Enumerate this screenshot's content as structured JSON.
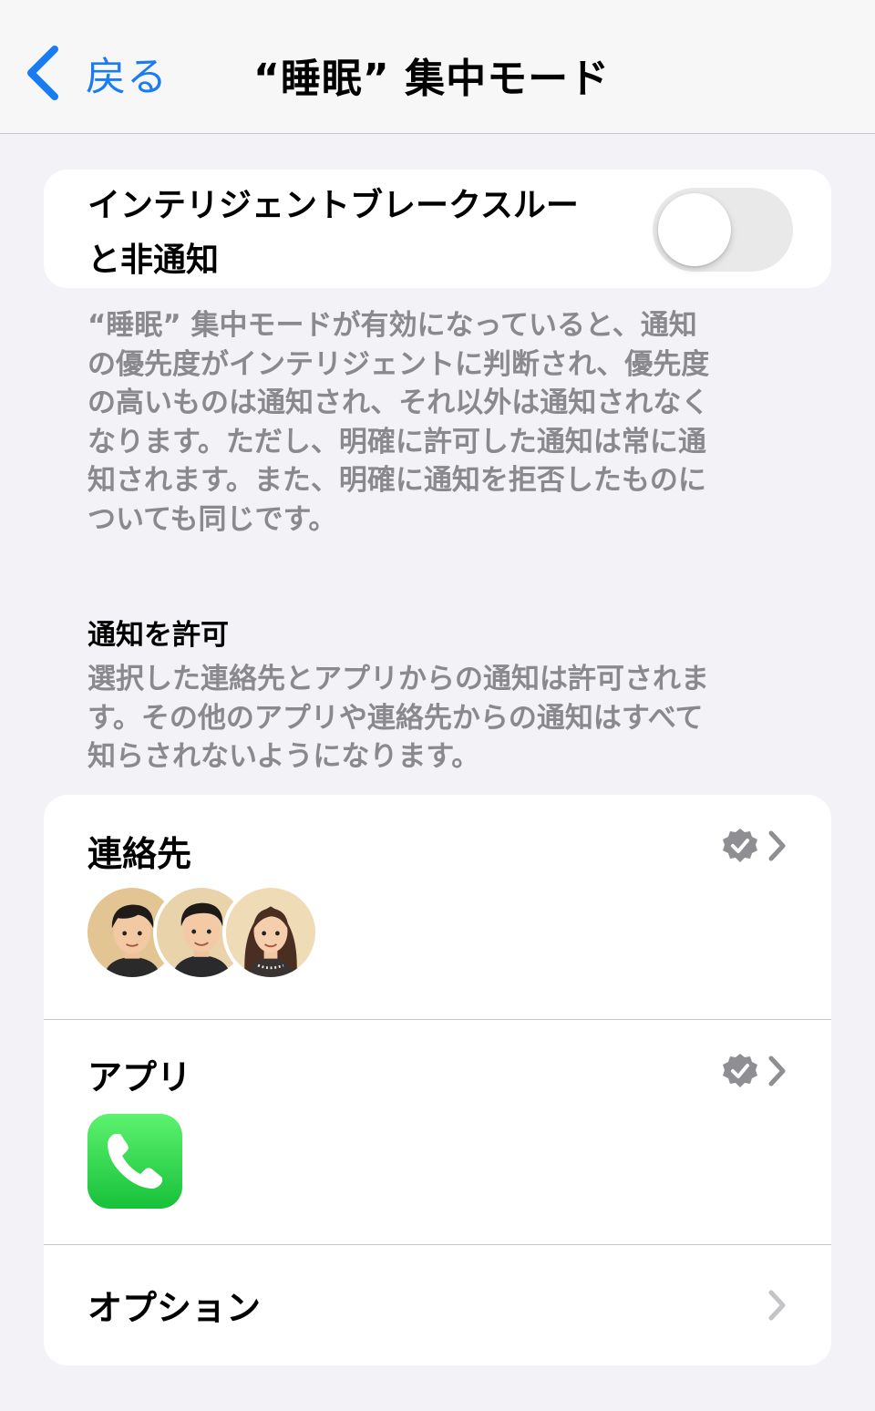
{
  "nav": {
    "back_label": "戻る",
    "title": "“睡眠” 集中モード"
  },
  "intelligent": {
    "label_line1": "インテリジェントブレークスルー",
    "label_line2": "と非通知",
    "toggle_on": false,
    "description_lines": [
      "“睡眠” 集中モードが有効になっていると、通知",
      "の優先度がインテリジェントに判断され、優先度",
      "の高いものは通知され、それ以外は通知されなく",
      "なります。ただし、明確に許可した通知は常に通",
      "知されます。また、明確に通知を拒否したものに",
      "ついても同じです。"
    ]
  },
  "allow": {
    "section_title": "通知を許可",
    "description_lines": [
      "選択した連絡先とアプリからの通知は許可されま",
      "す。その他のアプリや連絡先からの通知はすべて",
      "知らされないようになります。"
    ]
  },
  "list": {
    "contacts_label": "連絡先",
    "apps_label": "アプリ",
    "options_label": "オプション",
    "contacts_count": 3,
    "apps": [
      "phone-app-icon"
    ]
  },
  "colors": {
    "accent": "#1a7cf5",
    "background": "#f2f2f7",
    "secondary_text": "#8a8a8e",
    "phone_green": "#2fc84a"
  }
}
